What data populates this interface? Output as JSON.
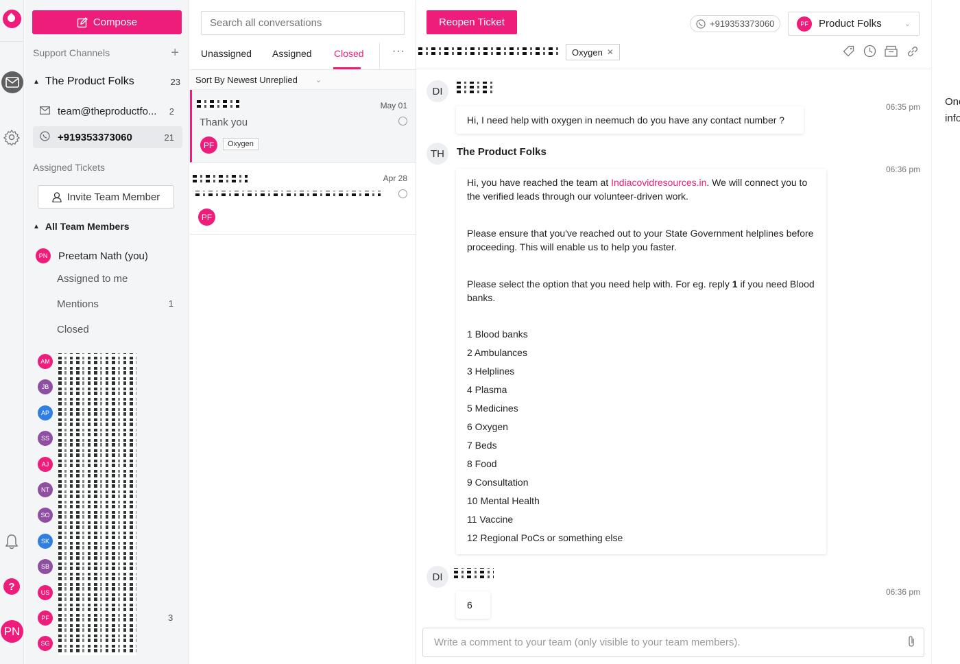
{
  "compose_label": "Compose",
  "sidebar": {
    "support_channels_title": "Support Channels",
    "group_name": "The Product Folks",
    "group_count": "23",
    "channels": [
      {
        "label": "team@theproductfo...",
        "count": "2"
      },
      {
        "label": "+919353373060",
        "count": "21"
      }
    ],
    "assigned_tickets_title": "Assigned Tickets",
    "invite_label": "Invite Team Member",
    "all_members_label": "All Team Members",
    "me": {
      "initials": "PN",
      "name": "Preetam Nath (you)"
    },
    "sub_items": [
      {
        "label": "Assigned to me",
        "count": ""
      },
      {
        "label": "Mentions",
        "count": "1"
      },
      {
        "label": "Closed",
        "count": ""
      }
    ],
    "team": [
      {
        "initials": "AM",
        "color": "#ee1c7a"
      },
      {
        "initials": "JB",
        "color": "#8e4fa0"
      },
      {
        "initials": "AP",
        "color": "#2f7ee0"
      },
      {
        "initials": "SS",
        "color": "#8e4fa0"
      },
      {
        "initials": "AJ",
        "color": "#ee1c7a"
      },
      {
        "initials": "NT",
        "color": "#8e4fa0"
      },
      {
        "initials": "SO",
        "color": "#8e4fa0"
      },
      {
        "initials": "SK",
        "color": "#2f7ee0"
      },
      {
        "initials": "SB",
        "color": "#8e4fa0"
      },
      {
        "initials": "US",
        "color": "#ee1c7a"
      },
      {
        "initials": "PF",
        "color": "#ee1c7a"
      },
      {
        "initials": "SG",
        "color": "#ee1c7a"
      }
    ],
    "pf_count": "3"
  },
  "list": {
    "search_placeholder": "Search all conversations",
    "tabs": [
      "Unassigned",
      "Assigned",
      "Closed"
    ],
    "more": "···",
    "sort_label": "Sort By Newest Unreplied",
    "conversations": [
      {
        "date": "May 01",
        "preview": "Thank you",
        "avatar": "PF",
        "tag": "Oxygen"
      },
      {
        "date": "Apr 28",
        "preview": "",
        "avatar": "PF",
        "tag": ""
      }
    ]
  },
  "main": {
    "reopen_label": "Reopen Ticket",
    "phone": "+919353373060",
    "brand_initials": "PF",
    "brand_name": "Product Folks",
    "tag": "Oxygen",
    "messages": [
      {
        "avatar": "DI",
        "time": "06:35 pm",
        "text": "Hi, I need help with oxygen in neemuch do you have any contact number ?"
      },
      {
        "avatar": "TH",
        "sender": "The Product Folks",
        "time": "06:36 pm",
        "p1a": "Hi, you have reached the team at ",
        "link": "Indiacovidresources.in",
        "p1b": ". We will connect you to the verified leads through our volunteer-driven work.",
        "p2": "Please ensure that you've reached out to your State Government helplines before proceeding. This will enable us to help you faster.",
        "p3a": "Please select the option that you need help with. For eg. reply ",
        "p3b": "1",
        "p3c": " if you need Blood banks.",
        "options": [
          "1 Blood banks",
          "2 Ambulances",
          "3 Helplines",
          "4 Plasma",
          "5 Medicines",
          "6 Oxygen",
          "7 Beds",
          "8 Food",
          "9 Consultation",
          "10 Mental Health",
          "11 Vaccine",
          "12 Regional PoCs or something else"
        ]
      },
      {
        "avatar": "DI",
        "time": "06:36 pm",
        "text": "6"
      }
    ],
    "composer_placeholder": "Write a comment to your team (only visible to your team members)."
  },
  "right_panel": {
    "line1": "One",
    "line2": "info"
  },
  "rail": {
    "me_initials": "PN",
    "help": "?"
  }
}
